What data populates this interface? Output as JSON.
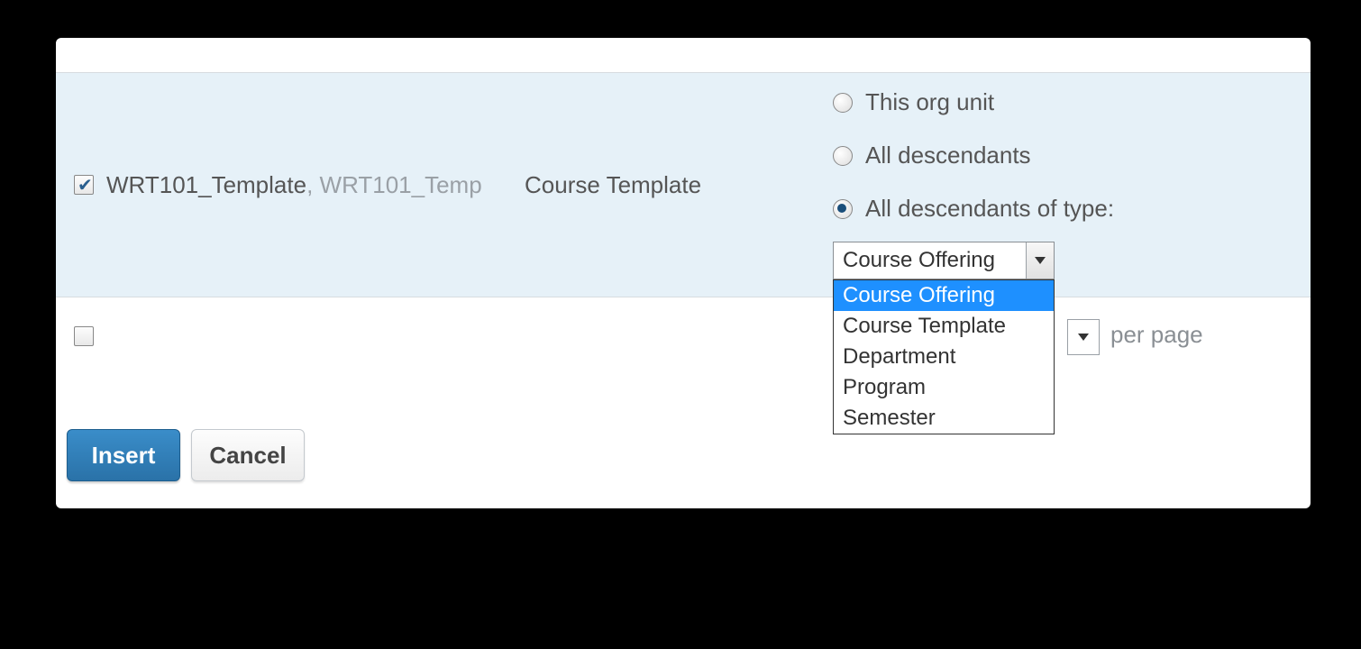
{
  "row": {
    "checked": true,
    "name_primary": "WRT101_Template",
    "name_separator": ", ",
    "name_secondary": "WRT101_Temp",
    "type": "Course Template"
  },
  "scope": {
    "options": {
      "this_unit": {
        "label": "This org unit",
        "checked": false
      },
      "all_desc": {
        "label": "All descendants",
        "checked": false
      },
      "typed_desc": {
        "label": "All descendants of type:",
        "checked": true
      }
    },
    "type_select": {
      "value": "Course Offering",
      "options": [
        "Course Offering",
        "Course Template",
        "Department",
        "Program",
        "Semester"
      ],
      "highlighted": "Course Offering"
    }
  },
  "pager": {
    "per_page_label": "per page"
  },
  "buttons": {
    "insert": "Insert",
    "cancel": "Cancel"
  }
}
